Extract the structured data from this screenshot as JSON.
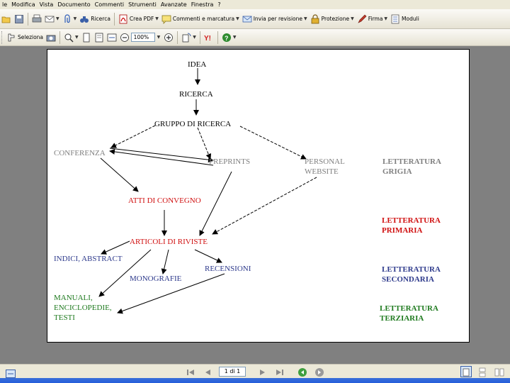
{
  "menubar": {
    "items": [
      "le",
      "Modifica",
      "Vista",
      "Documento",
      "Commenti",
      "Strumenti",
      "Avanzate",
      "Finestra",
      "?"
    ]
  },
  "toolbar1": {
    "search_label": "Ricerca",
    "create_pdf_label": "Crea PDF",
    "comment_markup_label": "Commenti e marcatura",
    "send_review_label": "Invia per revisione",
    "protect_label": "Protezione",
    "sign_label": "Firma",
    "forms_label": "Moduli"
  },
  "toolbar2": {
    "select_label": "Seleziona",
    "zoom_value": "100%"
  },
  "diagram": {
    "nodes": {
      "idea": "IDEA",
      "ricerca": "RICERCA",
      "gruppo": "GRUPPO DI RICERCA",
      "conferenza": "CONFERENZA",
      "preprints": "PREPRINTS",
      "personal_1": "PERSONAL",
      "personal_2": "WEBSITE",
      "atti": "ATTI DI CONVEGNO",
      "articoli": "ARTICOLI DI RIVISTE",
      "indici": "INDICI, ABSTRACT",
      "monografie": "MONOGRAFIE",
      "recensioni": "RECENSIONI",
      "manuali_1": "MANUALI,",
      "manuali_2": "ENCICLOPEDIE,",
      "manuali_3": "TESTI"
    },
    "categories": {
      "grigia_1": "LETTERATURA",
      "grigia_2": "GRIGIA",
      "primaria_1": "LETTERATURA",
      "primaria_2": "PRIMARIA",
      "secondaria_1": "LETTERATURA",
      "secondaria_2": "SECONDARIA",
      "terziaria_1": "LETTERATURA",
      "terziaria_2": "TERZIARIA"
    },
    "colors": {
      "black": "#000000",
      "grey": "#7f7f7f",
      "red": "#d01010",
      "navy": "#2e3a8c",
      "green": "#1e7a1e"
    }
  },
  "statusbar": {
    "page_indicator": "1 di 1"
  }
}
